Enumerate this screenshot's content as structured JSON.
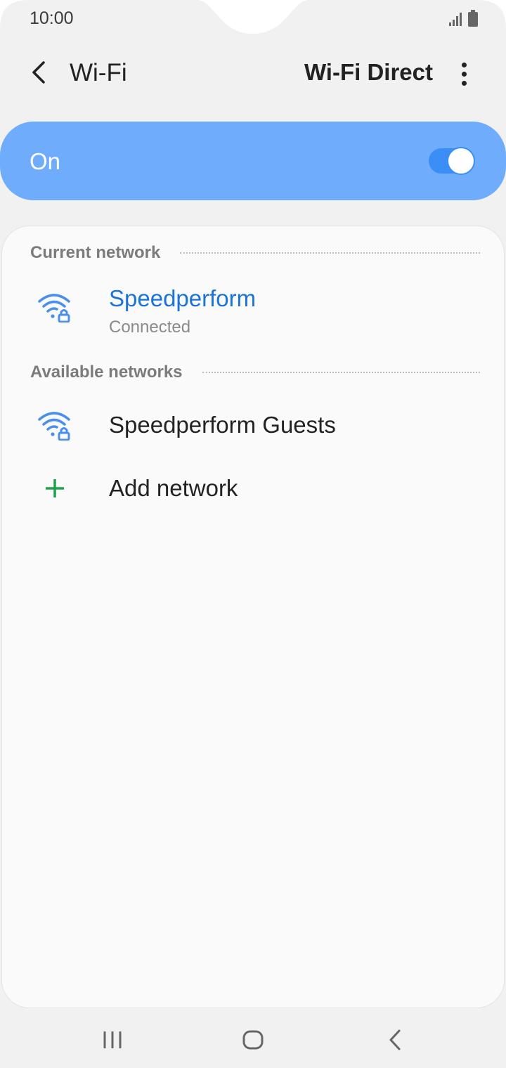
{
  "status_bar": {
    "time": "10:00",
    "signal_icon": "signal-icon",
    "battery_icon": "battery-icon"
  },
  "header": {
    "back_icon": "back-arrow-icon",
    "title": "Wi-Fi",
    "wifi_direct_label": "Wi-Fi Direct",
    "more_icon": "more-vert-icon"
  },
  "master_toggle": {
    "label": "On",
    "state": true,
    "card_color": "#70acfc",
    "switch_color": "#3a8ef6"
  },
  "current_network": {
    "section_title": "Current network",
    "name": "Speedperform",
    "status": "Connected",
    "icon": "wifi-lock-icon",
    "name_color": "#1a73d9"
  },
  "available_networks": {
    "section_title": "Available networks",
    "items": [
      {
        "name": "Speedperform Guests",
        "icon": "wifi-lock-icon"
      }
    ]
  },
  "add_network": {
    "label": "Add network",
    "icon": "plus-icon",
    "icon_color": "#1aa34a"
  },
  "nav_bar": {
    "recents_icon": "recents-icon",
    "home_icon": "home-icon",
    "back_icon": "nav-back-icon"
  }
}
